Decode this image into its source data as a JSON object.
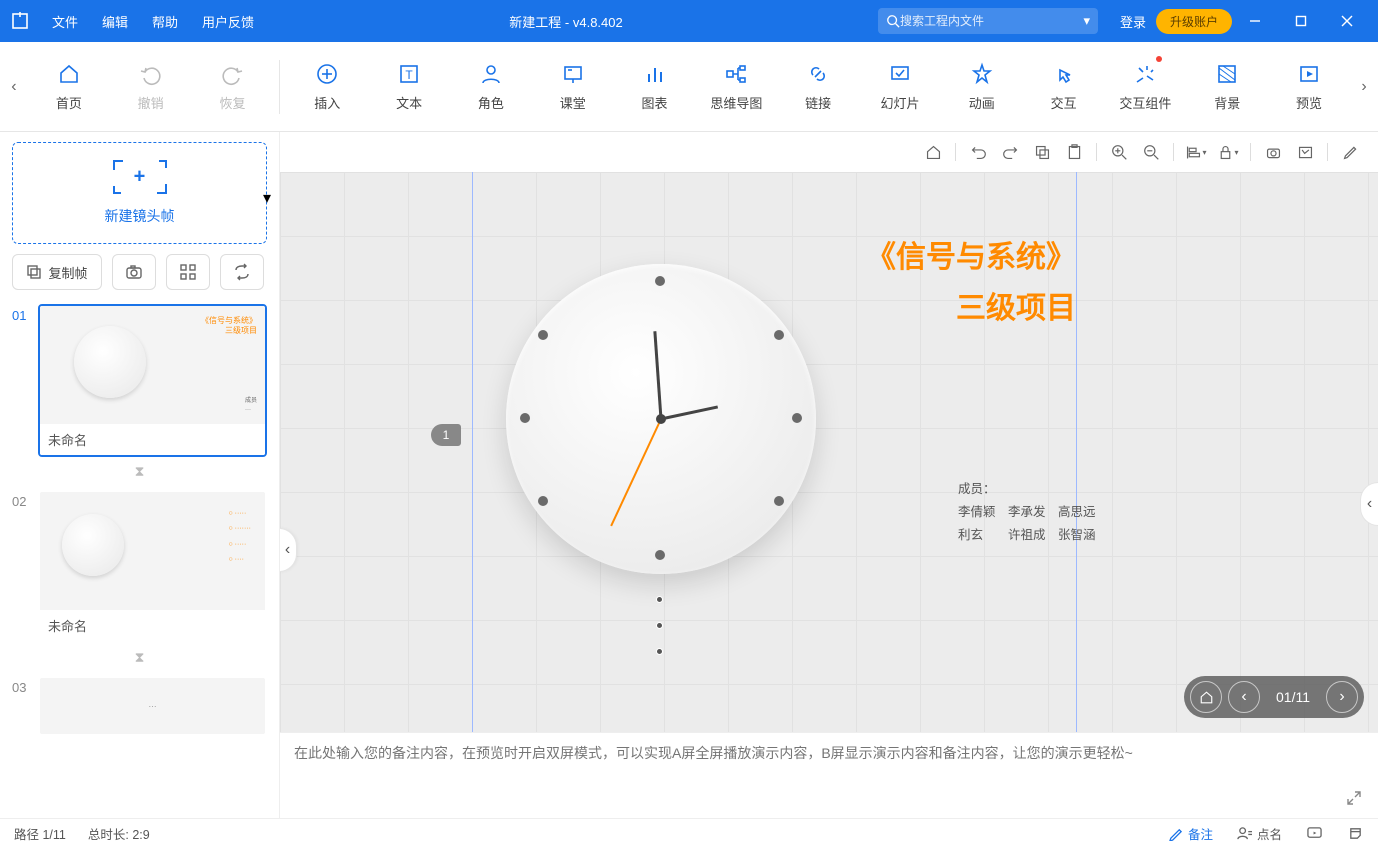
{
  "title": "新建工程 - v4.8.402",
  "menu": {
    "file": "文件",
    "edit": "编辑",
    "help": "帮助",
    "feedback": "用户反馈"
  },
  "search": {
    "placeholder": "搜索工程内文件"
  },
  "login": "登录",
  "upgrade": "升级账户",
  "ribbon": {
    "home": "首页",
    "undo": "撤销",
    "redo": "恢复",
    "insert": "插入",
    "text": "文本",
    "role": "角色",
    "class": "课堂",
    "chart": "图表",
    "mindmap": "思维导图",
    "link": "链接",
    "slide": "幻灯片",
    "anim": "动画",
    "interact": "交互",
    "widget": "交互组件",
    "bg": "背景",
    "preview": "预览"
  },
  "left": {
    "newframe": "新建镜头帧",
    "copyframe": "复制帧",
    "thumbs": [
      {
        "num": "01",
        "label": "未命名"
      },
      {
        "num": "02",
        "label": "未命名"
      },
      {
        "num": "03",
        "label": ""
      }
    ]
  },
  "slide": {
    "marker": "1",
    "title1": "《信号与系统》",
    "title2": "三级项目",
    "members_h": "成员：",
    "members_l1": "李倩颖　李承发　高思远",
    "members_l2": "利玄　　许祖成　张智涵"
  },
  "nav": {
    "pos": "01/11"
  },
  "notes": {
    "placeholder": "在此处输入您的备注内容，在预览时开启双屏模式，可以实现A屏全屏播放演示内容，B屏显示演示内容和备注内容，让您的演示更轻松~"
  },
  "status": {
    "path": "路径 1/11",
    "duration": "总时长: 2:9",
    "notesbtn": "备注",
    "namebtn": "点名"
  }
}
